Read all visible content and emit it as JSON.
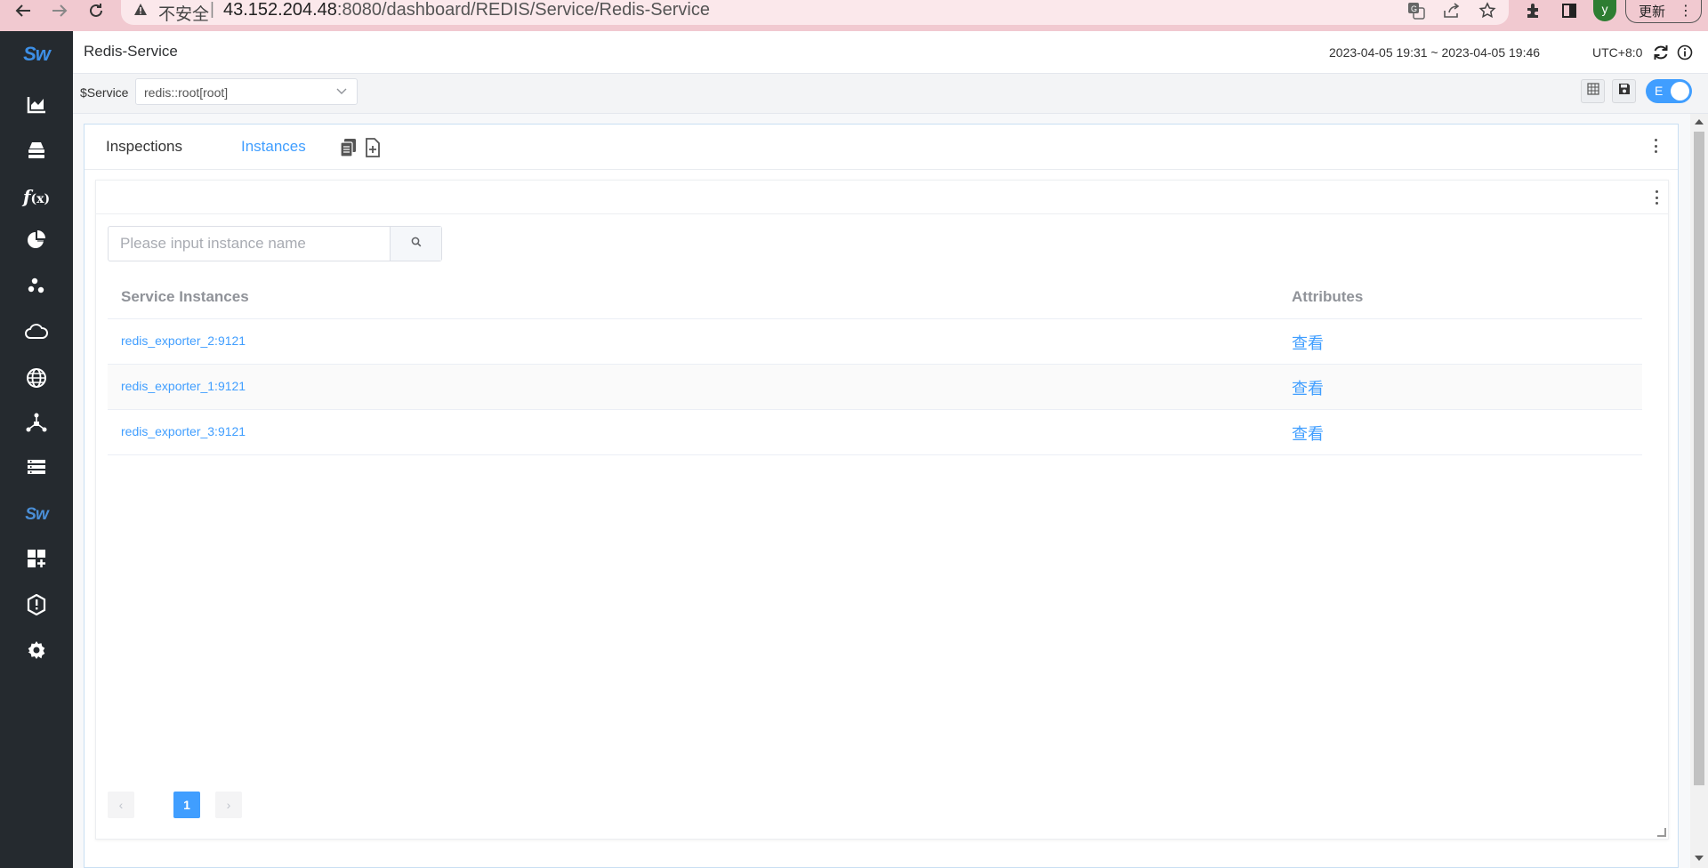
{
  "browser": {
    "url_warning": "不安全",
    "url_separator": "|",
    "url_host": "43.152.204.48",
    "url_path": ":8080/dashboard/REDIS/Service/Redis-Service",
    "profile_initial": "y",
    "update_label": "更新"
  },
  "sidebar": {
    "logo": "Sw",
    "items": [
      {
        "icon": "chart-area-icon"
      },
      {
        "icon": "database-icon"
      },
      {
        "icon": "function-icon",
        "label": "f(x)"
      },
      {
        "icon": "pie-chart-icon"
      },
      {
        "icon": "cluster-icon"
      },
      {
        "icon": "cloud-icon"
      },
      {
        "icon": "globe-icon"
      },
      {
        "icon": "network-icon"
      },
      {
        "icon": "list-icon"
      },
      {
        "icon": "skywalking-icon",
        "label": "Sw"
      },
      {
        "icon": "dashboard-add-icon"
      },
      {
        "icon": "alert-icon"
      },
      {
        "icon": "settings-icon"
      }
    ]
  },
  "header": {
    "title": "Redis-Service",
    "time_range": "2023-04-05 19:31 ~ 2023-04-05 19:46",
    "timezone": "UTC+8:0"
  },
  "toolbar": {
    "variable_label": "$Service",
    "service_value": "redis::root[root]",
    "edit_toggle_label": "E"
  },
  "widget": {
    "tabs": [
      {
        "label": "Inspections",
        "active": false
      },
      {
        "label": "Instances",
        "active": true
      }
    ],
    "search": {
      "placeholder": "Please input instance name"
    },
    "table": {
      "columns": [
        "Service Instances",
        "Attributes"
      ],
      "rows": [
        {
          "name": "redis_exporter_2:9121",
          "attributes": "查看"
        },
        {
          "name": "redis_exporter_1:9121",
          "attributes": "查看"
        },
        {
          "name": "redis_exporter_3:9121",
          "attributes": "查看"
        }
      ]
    },
    "pagination": {
      "current_page": "1",
      "prev": "‹",
      "next": "›"
    }
  },
  "colors": {
    "accent": "#409eff",
    "sidebar_bg": "#252a2f",
    "browser_bar": "#f1c9d0",
    "logo": "#3d8fe6"
  }
}
